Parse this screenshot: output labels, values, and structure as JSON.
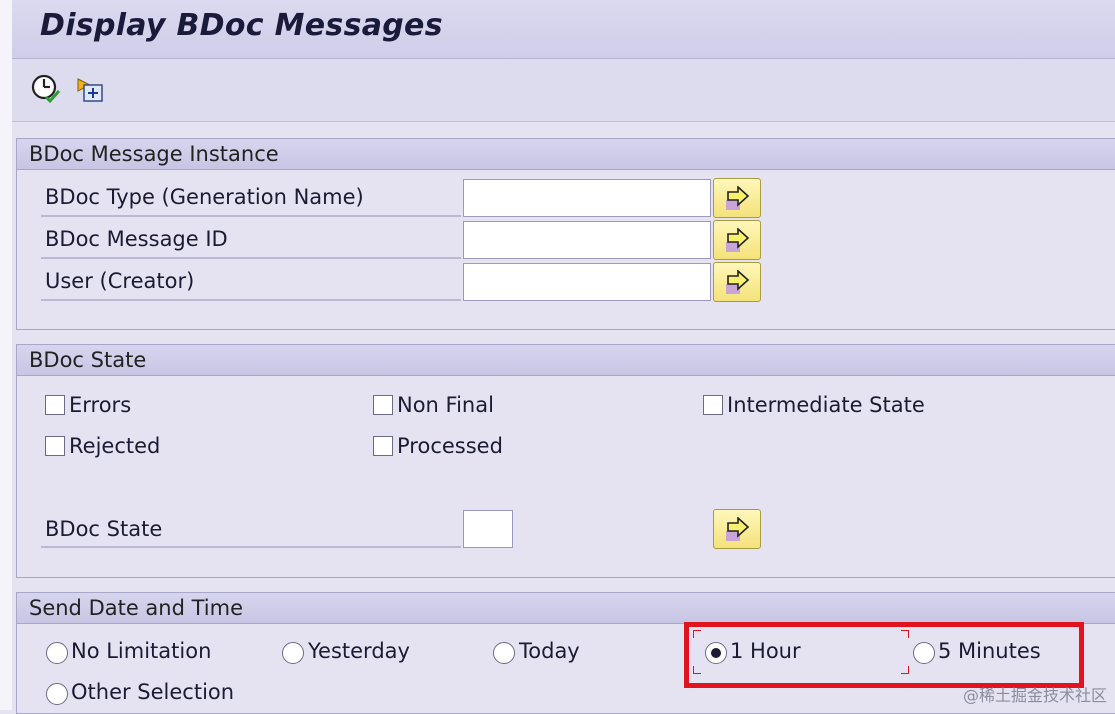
{
  "window": {
    "title": "Display BDoc Messages"
  },
  "toolbar": {
    "buttons": [
      {
        "icon": "execute-icon"
      },
      {
        "icon": "get-variant-icon"
      }
    ]
  },
  "instance_group": {
    "title": "BDoc Message Instance",
    "fields": [
      {
        "label": "BDoc Type (Generation Name)",
        "value": ""
      },
      {
        "label": "BDoc Message ID",
        "value": ""
      },
      {
        "label": "User (Creator)",
        "value": ""
      }
    ]
  },
  "state_group": {
    "title": "BDoc State",
    "checkboxes": {
      "errors": "Errors",
      "non_final": "Non Final",
      "intermediate": "Intermediate State",
      "rejected": "Rejected",
      "processed": "Processed"
    },
    "state_field": {
      "label": "BDoc State",
      "value": ""
    }
  },
  "time_group": {
    "title": "Send Date and Time",
    "options": {
      "no_limitation": "No Limitation",
      "yesterday": "Yesterday",
      "today": "Today",
      "one_hour": "1 Hour",
      "five_minutes": "5 Minutes",
      "other": "Other Selection"
    },
    "selected": "1 Hour"
  },
  "watermark": "@稀土掘金技术社区",
  "colors": {
    "highlight": "#e0141e",
    "button_yellow": "#f4e27a"
  }
}
